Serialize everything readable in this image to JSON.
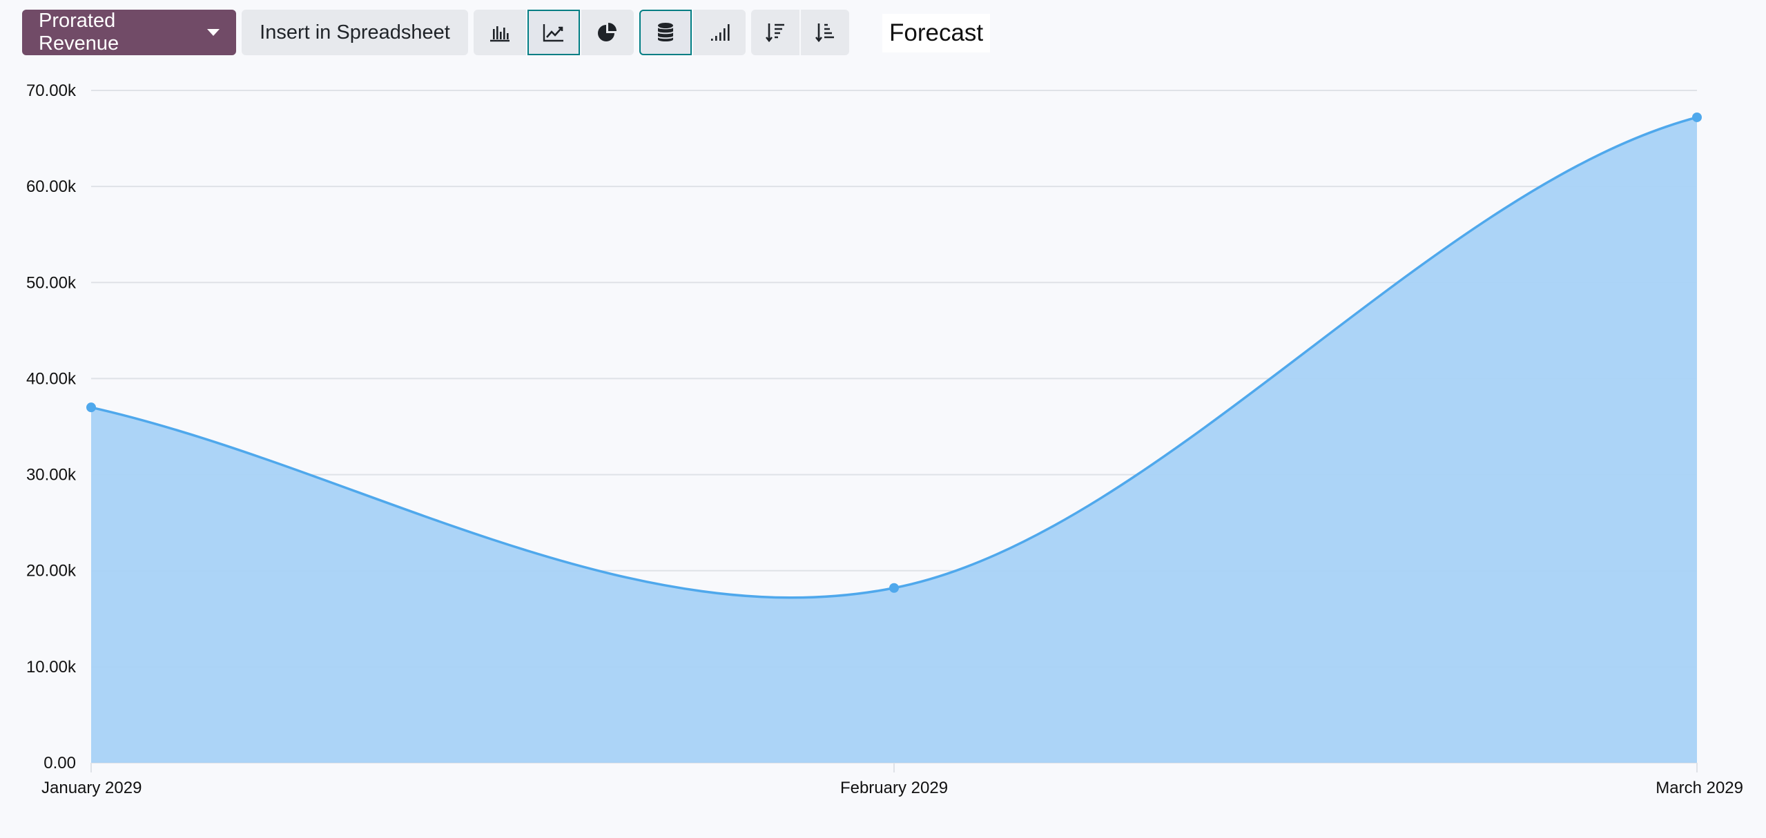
{
  "toolbar": {
    "measure_label": "Prorated Revenue",
    "insert_label": "Insert in Spreadsheet",
    "chart_type_icons": [
      "bar-chart-icon",
      "line-chart-icon",
      "pie-chart-icon"
    ],
    "option_icons": [
      "stacked-database-icon",
      "cumulative-bars-icon"
    ],
    "sort_icons": [
      "sort-descending-icon",
      "sort-ascending-icon"
    ]
  },
  "title": "Forecast",
  "colors": {
    "primary": "#714b67",
    "active_border": "#017e84",
    "line": "#4fa8ec",
    "area": "#a8d2f7"
  },
  "chart_data": {
    "type": "area",
    "categories": [
      "January  2029",
      "February  2029",
      "March  2029"
    ],
    "series": [
      {
        "values": [
          37000,
          18200,
          67200
        ]
      }
    ],
    "yticks": [
      "0.00",
      "10.00k",
      "20.00k",
      "30.00k",
      "40.00k",
      "50.00k",
      "60.00k",
      "70.00k"
    ],
    "ylim": [
      0,
      70000
    ],
    "grid": true,
    "legend": "none"
  }
}
